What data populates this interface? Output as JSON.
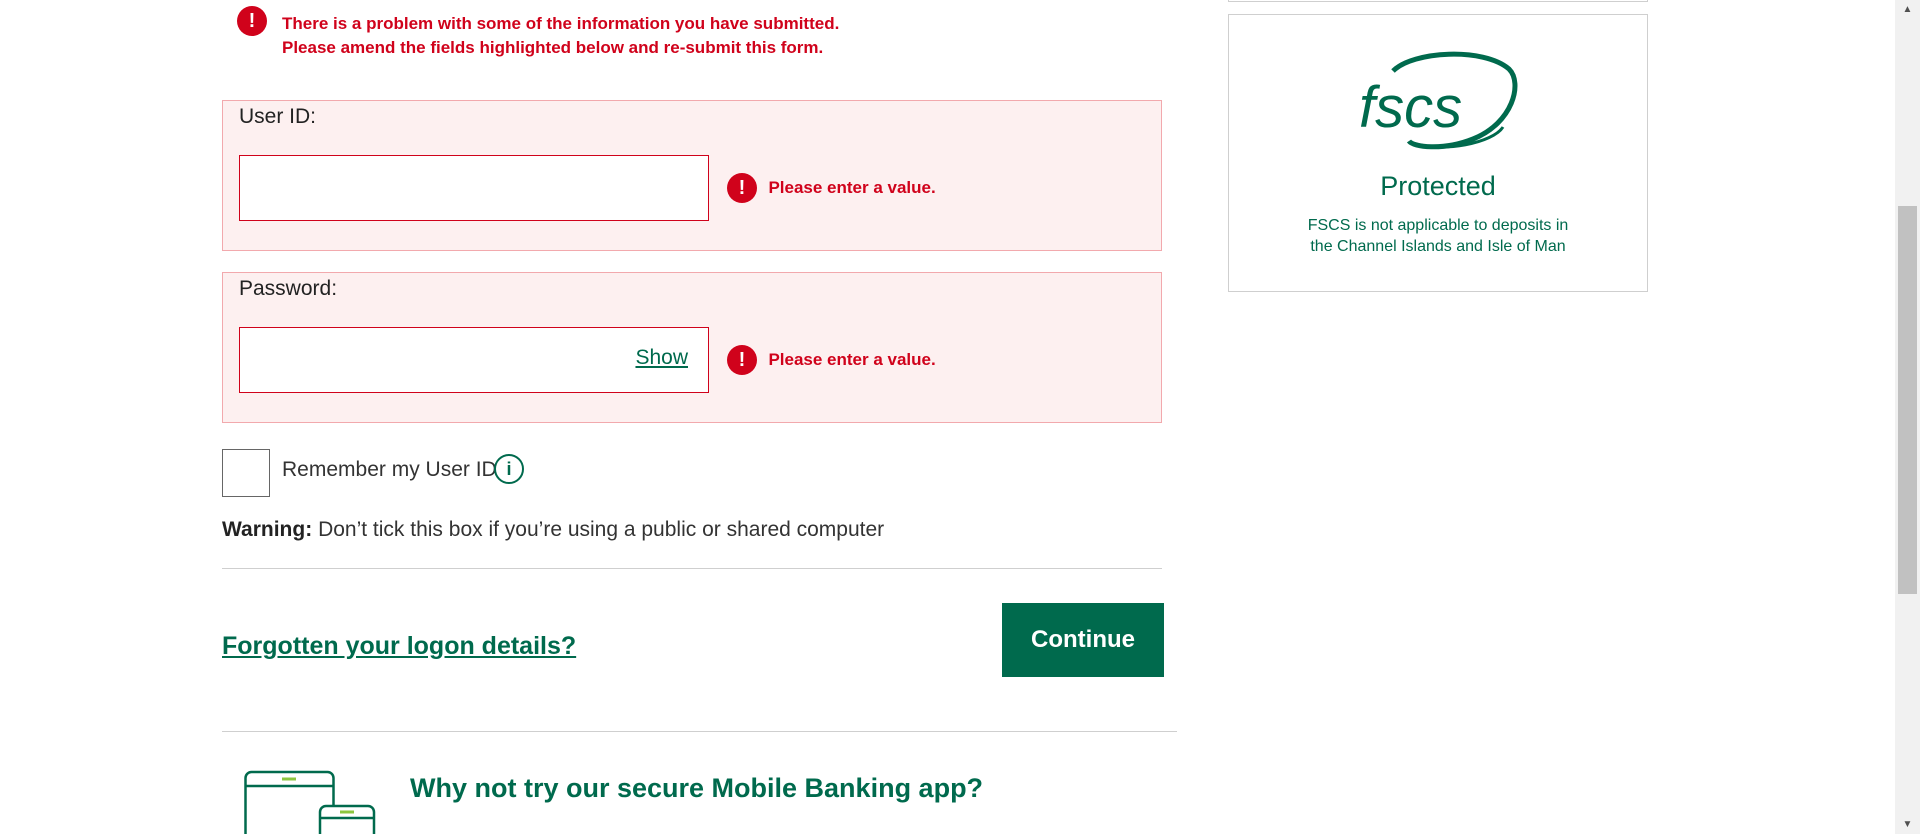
{
  "error_summary": {
    "line1": "There is a problem with some of the information you have submitted.",
    "line2": "Please amend the fields highlighted below and re-submit this form."
  },
  "error_icon_glyph": "!",
  "user_id": {
    "label": "User ID:",
    "value": "",
    "error": "Please enter a value."
  },
  "password": {
    "label": "Password:",
    "value": "",
    "show_label": "Show",
    "error": "Please enter a value."
  },
  "remember": {
    "label": "Remember my User ID",
    "checked": false,
    "info_glyph": "i"
  },
  "warning": {
    "prefix": "Warning:",
    "text": "Don’t tick this box if you’re using a public or shared computer"
  },
  "forgot_link": "Forgotten your logon details?",
  "continue_button": "Continue",
  "app_promo": {
    "title": "Why not try our secure Mobile Banking app?",
    "icon": "mobile-tablet-icon"
  },
  "fscs": {
    "logo_text": "fscs",
    "protected": "Protected",
    "note_line1": "FSCS is not applicable to deposits in",
    "note_line2": "the Channel Islands and Isle of Man"
  },
  "scrollbar": {
    "up_arrow": "▲",
    "down_arrow": "▼"
  },
  "colors": {
    "brand_green": "#006a4d",
    "error_red": "#d0021b",
    "error_bg": "#fdf0f0"
  }
}
